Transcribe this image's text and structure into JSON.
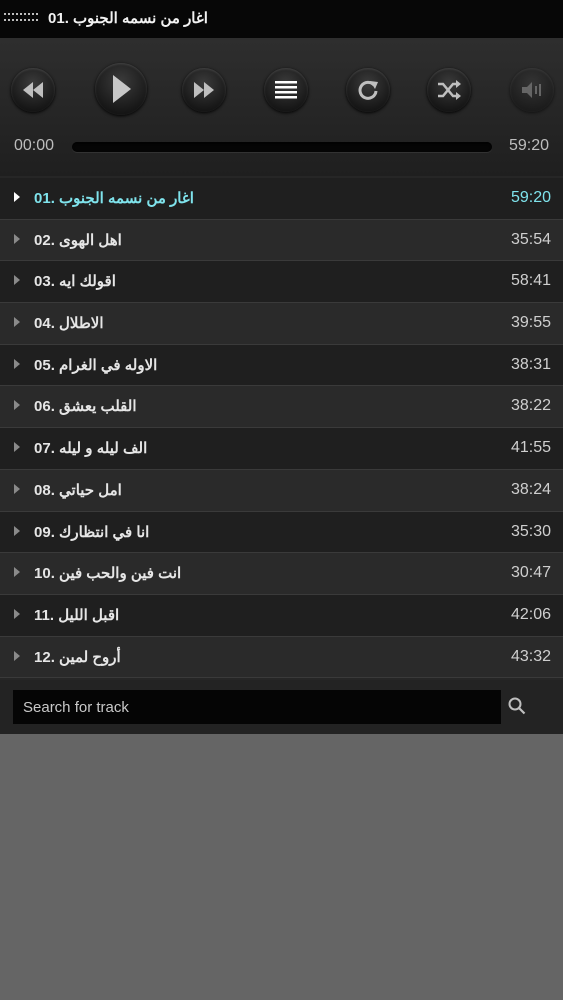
{
  "now_playing": {
    "title": "اغار من نسمه الجنوب .01"
  },
  "controls": {
    "buttons": [
      {
        "name": "rewind-button",
        "icon": "rewind-icon"
      },
      {
        "name": "play-button",
        "icon": "play-icon"
      },
      {
        "name": "fast-forward-button",
        "icon": "fast-forward-icon"
      },
      {
        "name": "playlist-button",
        "icon": "list-icon"
      },
      {
        "name": "repeat-button",
        "icon": "repeat-icon"
      },
      {
        "name": "shuffle-button",
        "icon": "shuffle-icon"
      },
      {
        "name": "volume-button",
        "icon": "volume-icon"
      }
    ]
  },
  "progress": {
    "current": "00:00",
    "total": "59:20",
    "fraction": 0.0
  },
  "tracks": [
    {
      "title": "اغار من نسمه الجنوب .01",
      "duration": "59:20",
      "active": true
    },
    {
      "title": "اهل الهوى .02",
      "duration": "35:54"
    },
    {
      "title": "اقولك ايه .03",
      "duration": "58:41"
    },
    {
      "title": "الاطلال .04",
      "duration": "39:55"
    },
    {
      "title": "الاوله في الغرام .05",
      "duration": "38:31"
    },
    {
      "title": "القلب يعشق .06",
      "duration": "38:22"
    },
    {
      "title": "الف ليله و ليله .07",
      "duration": "41:55"
    },
    {
      "title": "امل حياتي .08",
      "duration": "38:24"
    },
    {
      "title": "انا في انتظارك .09",
      "duration": "35:30"
    },
    {
      "title": "انت فين والحب فين .10",
      "duration": "30:47"
    },
    {
      "title": "اقبل الليل .11",
      "duration": "42:06"
    },
    {
      "title": "أروح لمين .12",
      "duration": "43:32"
    }
  ],
  "search": {
    "placeholder": "Search for track"
  },
  "colors": {
    "active": "#7fe3ec",
    "background": "#656565",
    "panel": "#262626"
  }
}
